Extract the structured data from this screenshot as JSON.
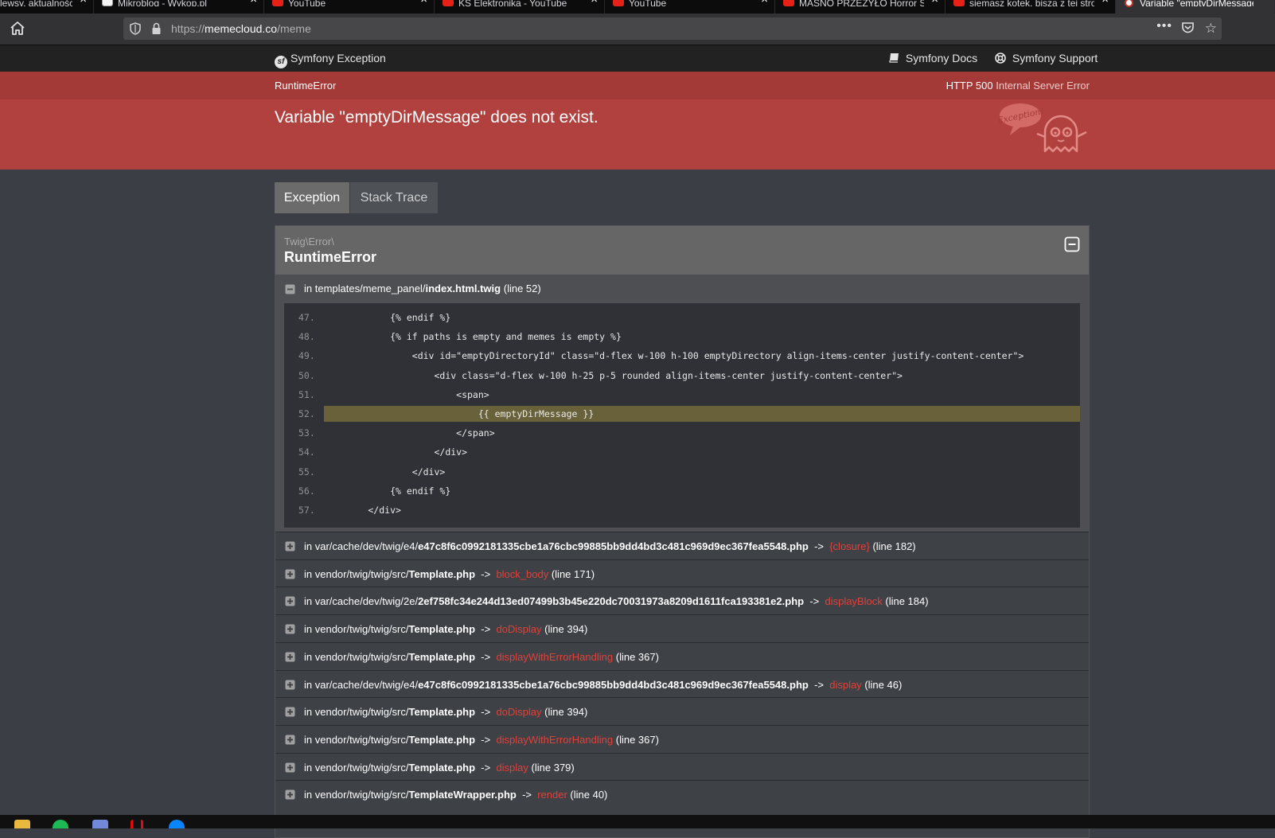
{
  "browser": {
    "tabs": [
      {
        "title": "lewsy, aktualności",
        "type": "other"
      },
      {
        "title": "Mikroblog - Wykop.pl",
        "type": "wykop"
      },
      {
        "title": "YouTube",
        "type": "youtube"
      },
      {
        "title": "KS Elektronika - YouTube",
        "type": "youtube"
      },
      {
        "title": "YouTube",
        "type": "youtube"
      },
      {
        "title": "MASNO PRZEŻYŁO Horror St",
        "type": "youtube"
      },
      {
        "title": "siemasz kotek, bisza z tej stro",
        "type": "youtube"
      },
      {
        "title": "Variable \"emptyDirMessage\"",
        "type": "symfony"
      }
    ],
    "url_scheme": "https://",
    "url_host": "memecloud.co",
    "url_path": "/meme",
    "more_label": "•••"
  },
  "header": {
    "brand": "Symfony Exception",
    "docs": "Symfony Docs",
    "support": "Symfony Support"
  },
  "exception": {
    "class_short": "RuntimeError",
    "http_code": "HTTP 500",
    "http_text": "Internal Server Error",
    "message": "Variable \"emptyDirMessage\" does not exist.",
    "ghost_label": "Exception!"
  },
  "tabs": {
    "exception": "Exception",
    "stack_trace": "Stack Trace"
  },
  "trace": {
    "namespace": "Twig\\Error\\",
    "class": "RuntimeError",
    "first_frame": {
      "prefix": "in templates/meme_panel/",
      "file": "index.html.twig",
      "line": "(line 52)"
    },
    "code_lines": [
      {
        "num": "47.",
        "code": "            {% endif %}",
        "highlight": false
      },
      {
        "num": "48.",
        "code": "            {% if paths is empty and memes is empty %}",
        "highlight": false
      },
      {
        "num": "49.",
        "code": "                <div id=\"emptyDirectoryId\" class=\"d-flex w-100 h-100 emptyDirectory align-items-center justify-content-center\">",
        "highlight": false
      },
      {
        "num": "50.",
        "code": "                    <div class=\"d-flex w-100 h-25 p-5 rounded align-items-center justify-content-center\">",
        "highlight": false
      },
      {
        "num": "51.",
        "code": "                        <span>",
        "highlight": false
      },
      {
        "num": "52.",
        "code": "                            {{ emptyDirMessage }}",
        "highlight": true
      },
      {
        "num": "53.",
        "code": "                        </span>",
        "highlight": false
      },
      {
        "num": "54.",
        "code": "                    </div>",
        "highlight": false
      },
      {
        "num": "55.",
        "code": "                </div>",
        "highlight": false
      },
      {
        "num": "56.",
        "code": "            {% endif %}",
        "highlight": false
      },
      {
        "num": "57.",
        "code": "        </div>",
        "highlight": false
      }
    ],
    "frames": [
      {
        "prefix": "in var/cache/dev/twig/e4/",
        "file": "e47c8f6c0992181335cbe1a76cbc99885bb9dd4bd3c481c969d9ec367fea5548.php",
        "arrow": "->",
        "func": "{closure}",
        "line": "(line 182)"
      },
      {
        "prefix": "in vendor/twig/twig/src/",
        "file": "Template.php",
        "arrow": "->",
        "func": "block_body",
        "line": "(line 171)"
      },
      {
        "prefix": "in var/cache/dev/twig/2e/",
        "file": "2ef758fc34e244d13ed07499b3b45e220dc70031973a8209d1611fca193381e2.php",
        "arrow": "->",
        "func": "displayBlock",
        "line": "(line 184)"
      },
      {
        "prefix": "in vendor/twig/twig/src/",
        "file": "Template.php",
        "arrow": "->",
        "func": "doDisplay",
        "line": "(line 394)"
      },
      {
        "prefix": "in vendor/twig/twig/src/",
        "file": "Template.php",
        "arrow": "->",
        "func": "displayWithErrorHandling",
        "line": "(line 367)"
      },
      {
        "prefix": "in var/cache/dev/twig/e4/",
        "file": "e47c8f6c0992181335cbe1a76cbc99885bb9dd4bd3c481c969d9ec367fea5548.php",
        "arrow": "->",
        "func": "display",
        "line": "(line 46)"
      },
      {
        "prefix": "in vendor/twig/twig/src/",
        "file": "Template.php",
        "arrow": "->",
        "func": "doDisplay",
        "line": "(line 394)"
      },
      {
        "prefix": "in vendor/twig/twig/src/",
        "file": "Template.php",
        "arrow": "->",
        "func": "displayWithErrorHandling",
        "line": "(line 367)"
      },
      {
        "prefix": "in vendor/twig/twig/src/",
        "file": "Template.php",
        "arrow": "->",
        "func": "display",
        "line": "(line 379)"
      },
      {
        "prefix": "in vendor/twig/twig/src/",
        "file": "TemplateWrapper.php",
        "arrow": "->",
        "func": "render",
        "line": "(line 40)"
      }
    ]
  },
  "colors": {
    "accent_red": "#b0413e",
    "func_red": "#e0413a",
    "highlight": "#69613a"
  },
  "taskbar": {
    "apps": [
      "file-explorer-icon",
      "spotify-icon",
      "discord-icon",
      "netflix-icon",
      "messenger-icon"
    ]
  }
}
